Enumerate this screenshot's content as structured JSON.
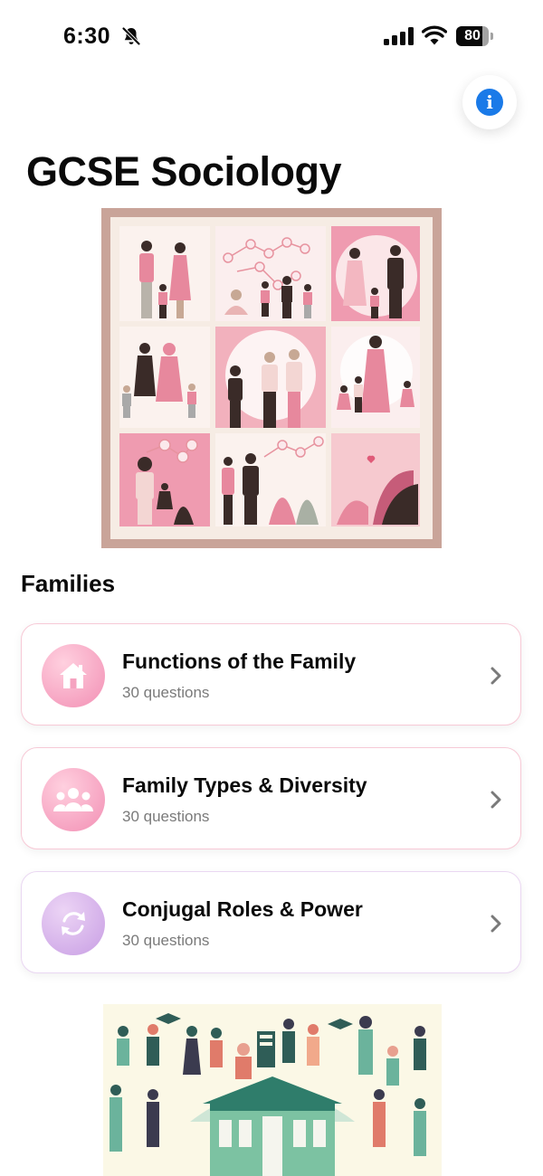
{
  "status_bar": {
    "time": "6:30",
    "battery_level": "80",
    "icons": [
      "bell-slash-icon",
      "signal-icon",
      "wifi-icon",
      "battery-icon"
    ]
  },
  "info_button": {
    "icon": "info-icon",
    "glyph": "i"
  },
  "page_title": "GCSE Sociology",
  "section": {
    "title": "Families",
    "topics": [
      {
        "title": "Functions of the Family",
        "subtitle": "30 questions",
        "icon": "home-icon",
        "accent": "#f5a3c0"
      },
      {
        "title": "Family Types & Diversity",
        "subtitle": "30 questions",
        "icon": "people-icon",
        "accent": "#f49ab8"
      },
      {
        "title": "Conjugal Roles & Power",
        "subtitle": "30 questions",
        "icon": "refresh-icon",
        "accent": "#d7a8e8"
      }
    ]
  },
  "colors": {
    "info_blue": "#1a7ae8",
    "pink_border": "#f7c9d6",
    "lavender_border": "#ead7f2",
    "pink_gradient": [
      "#ffd0df",
      "#f28fb4"
    ],
    "lavender_gradient": [
      "#ecd4f5",
      "#c89ee4"
    ]
  }
}
